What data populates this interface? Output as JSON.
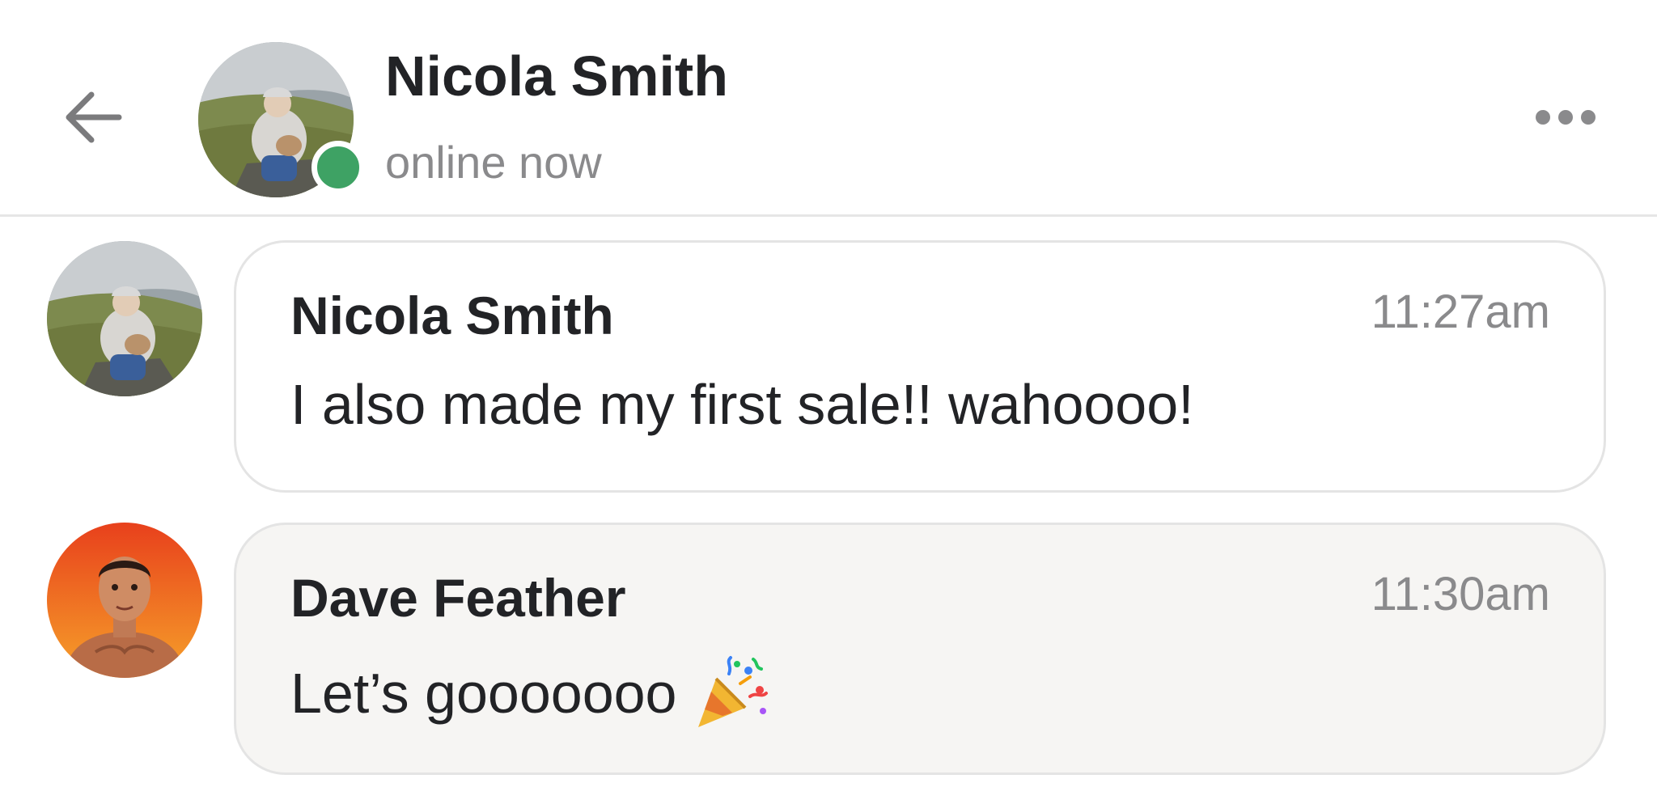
{
  "header": {
    "name": "Nicola Smith",
    "status": "online now",
    "status_color": "#3ea264",
    "back_icon": "arrow-left-icon",
    "more_icon": "more-horizontal-icon"
  },
  "messages": [
    {
      "sender": "Nicola Smith",
      "time": "11:27am",
      "text": "I also made my first sale!! wahoooo!",
      "avatar": "user-photo-nicola"
    },
    {
      "sender": "Dave Feather",
      "time": "11:30am",
      "text": "Let’s gooooooo",
      "emoji": "party-popper-icon",
      "avatar": "user-photo-dave"
    }
  ]
}
